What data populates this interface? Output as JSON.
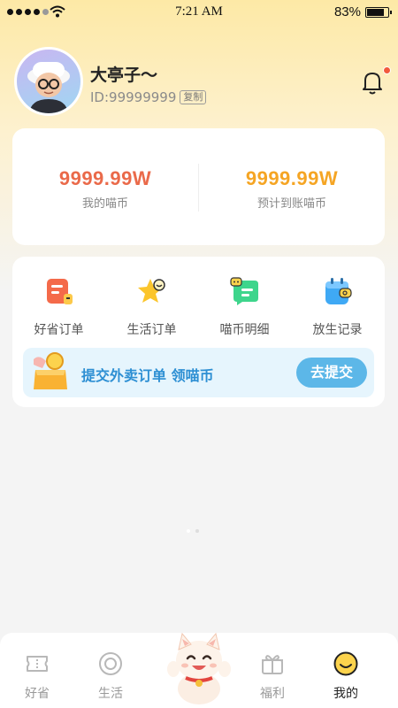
{
  "status_bar": {
    "time": "7:21 AM",
    "battery_percent_label": "83%",
    "battery_level": 0.83,
    "signal_bars_on": 4
  },
  "profile": {
    "username": "大亭子～",
    "user_id": "ID:99999999",
    "copy_label": "复制",
    "has_notification": true
  },
  "coins": {
    "my_coins_value": "9999.99W",
    "my_coins_label": "我的喵币",
    "my_coins_color": "#ea6a4a",
    "expected_value": "9999.99W",
    "expected_label": "预计到账喵币",
    "expected_color": "#f5a524"
  },
  "menu": {
    "items": [
      {
        "label": "好省订单",
        "icon": "order-icon"
      },
      {
        "label": "生活订单",
        "icon": "star-icon"
      },
      {
        "label": "喵币明细",
        "icon": "chat-detail-icon"
      },
      {
        "label": "放生记录",
        "icon": "calendar-icon"
      }
    ],
    "promo": {
      "text": "提交外卖订单 领喵币",
      "button": "去提交"
    }
  },
  "tabbar": {
    "tabs": [
      {
        "label": "好省",
        "icon": "ticket-icon"
      },
      {
        "label": "生活",
        "icon": "circle-icon"
      },
      {
        "label": "福利",
        "icon": "gift-icon"
      },
      {
        "label": "我的",
        "icon": "smile-icon"
      }
    ],
    "active": "我的"
  }
}
